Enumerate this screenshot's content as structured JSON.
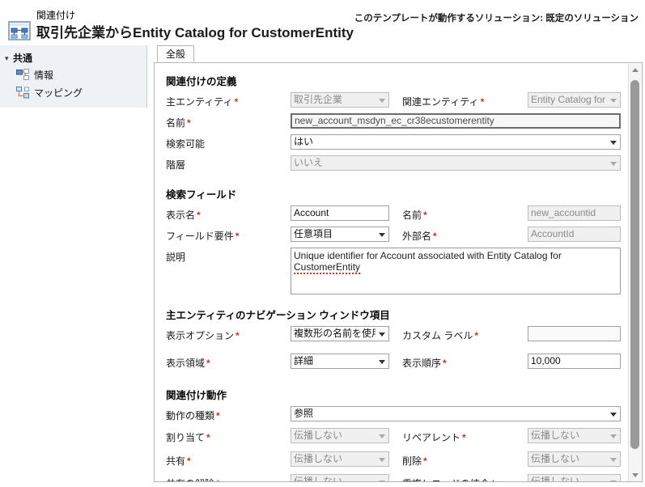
{
  "header": {
    "subtitle": "関連付け",
    "title": "取引先企業からEntity Catalog for CustomerEntity",
    "solution_text": "このテンプレートが動作するソリューション: 既定のソリューション",
    "icon": "relationship-icon"
  },
  "sidebar": {
    "group_label": "共通",
    "items": [
      {
        "label": "情報",
        "icon": "information-node-icon"
      },
      {
        "label": "マッピング",
        "icon": "mapping-node-icon"
      }
    ]
  },
  "tabs": [
    {
      "label": "全般",
      "selected": true
    }
  ],
  "sections": {
    "definition": {
      "title": "関連付けの定義",
      "primary_entity": {
        "label": "主エンティティ",
        "required": true,
        "value": "取引先企業",
        "disabled": true
      },
      "related_entity": {
        "label": "関連エンティティ",
        "required": true,
        "value": "Entity Catalog for",
        "disabled": true
      },
      "name": {
        "label": "名前",
        "required": true,
        "value": "new_account_msdyn_ec_cr38ecustomerentity",
        "disabled": true
      },
      "searchable": {
        "label": "検索可能",
        "required": false,
        "value": "はい",
        "disabled": false
      },
      "hierarchical": {
        "label": "階層",
        "required": false,
        "value": "いいえ",
        "disabled": true
      }
    },
    "lookup": {
      "title": "検索フィールド",
      "display_name": {
        "label": "表示名",
        "required": true,
        "value": "Account",
        "disabled": false
      },
      "schema_name": {
        "label": "名前",
        "required": true,
        "value": "new_accountid",
        "disabled": true
      },
      "field_requirement": {
        "label": "フィールド要件",
        "required": true,
        "value": "任意項目",
        "disabled": false
      },
      "external_name": {
        "label": "外部名",
        "required": true,
        "value": "AccountId",
        "disabled": true
      },
      "description": {
        "label": "説明",
        "required": false,
        "value_before": "Unique identifier for Account associated with Entity Catalog for ",
        "value_spellchecked": "CustomerEntity"
      }
    },
    "navigation": {
      "title": "主エンティティのナビゲーション ウィンドウ項目",
      "display_option": {
        "label": "表示オプション",
        "required": true,
        "value": "複数形の名前を使用",
        "disabled": false
      },
      "custom_label": {
        "label": "カスタム ラベル",
        "required": true,
        "value": "",
        "disabled": false
      },
      "display_area": {
        "label": "表示領域",
        "required": true,
        "value": "詳細",
        "disabled": false
      },
      "display_order": {
        "label": "表示順序",
        "required": true,
        "value": "10,000",
        "disabled": false
      }
    },
    "behavior": {
      "title": "関連付け動作",
      "behavior_type": {
        "label": "動作の種類",
        "required": true,
        "value": "参照",
        "disabled": false
      },
      "assign": {
        "label": "割り当て",
        "required": true,
        "value": "伝播しない",
        "disabled": true
      },
      "reparent": {
        "label": "リペアレント",
        "required": true,
        "value": "伝播しない",
        "disabled": true
      },
      "share": {
        "label": "共有",
        "required": true,
        "value": "伝播しない",
        "disabled": true
      },
      "delete": {
        "label": "削除",
        "required": true,
        "value": "伝播しない",
        "disabled": true
      },
      "unshare": {
        "label": "共有の解除",
        "required": true,
        "value": "伝播しない",
        "disabled": true
      },
      "merge": {
        "label": "重複レコードの統合",
        "required": true,
        "value": "伝播しない",
        "disabled": true
      }
    }
  },
  "scrollbar": {
    "up_icon": "scroll-up-arrow-icon",
    "down_icon": "scroll-down-arrow-icon"
  },
  "colors": {
    "required_marker": "#c0392b",
    "nav_background": "#eef1f6",
    "disabled_field": "#f0f0f0"
  }
}
